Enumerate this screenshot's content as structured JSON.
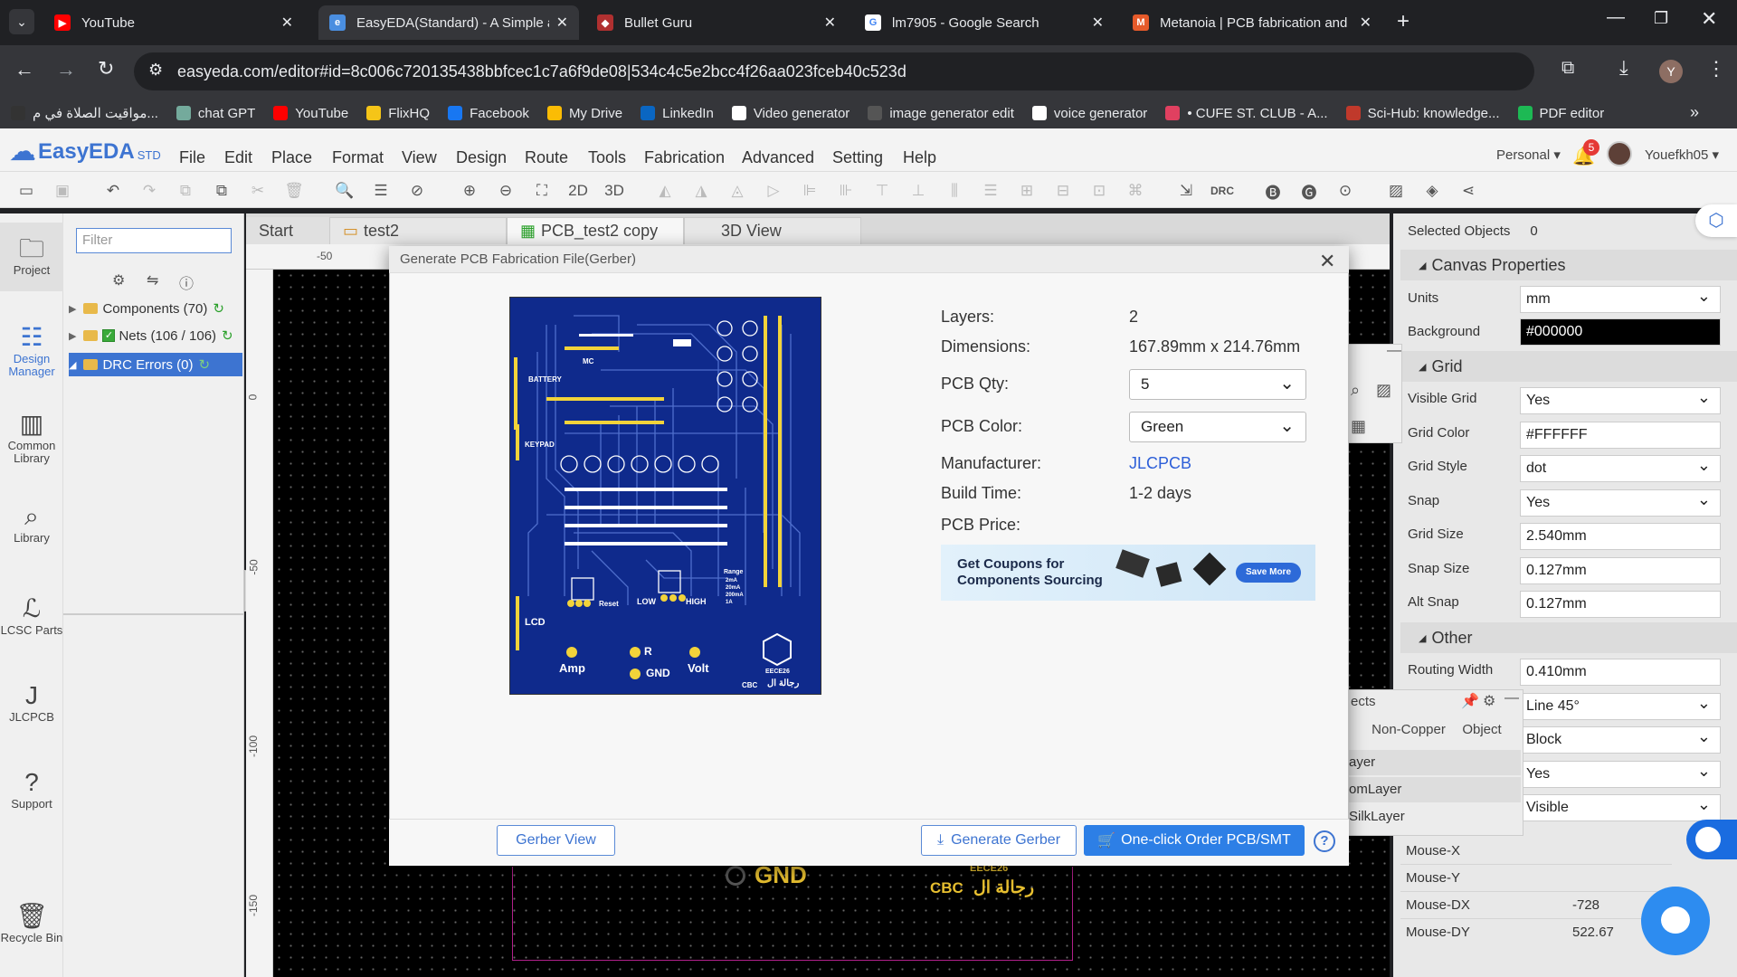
{
  "browser": {
    "tabs": [
      {
        "title": "YouTube",
        "color": "#ff0000",
        "glyph": "▶"
      },
      {
        "title": "EasyEDA(Standard) - A Simple a",
        "color": "#4a8ee0",
        "glyph": "e"
      },
      {
        "title": "Bullet Guru",
        "color": "#b03030",
        "glyph": "◆"
      },
      {
        "title": "lm7905 - Google Search",
        "color": "#ffffff",
        "glyph": "G"
      },
      {
        "title": "Metanoia | PCB fabrication and",
        "color": "#e65a2a",
        "glyph": "M"
      }
    ],
    "url": "easyeda.com/editor#id=8c006c720135438bbfcec1c7a6f9de08|534c4c5e2bcc4f26aa023fceb40c523d",
    "profile_initial": "Y",
    "bookmarks": [
      {
        "label": "مواقيت الصلاة في م...",
        "color": "#333"
      },
      {
        "label": "chat GPT",
        "color": "#74aa9c"
      },
      {
        "label": "YouTube",
        "color": "#ff0000"
      },
      {
        "label": "FlixHQ",
        "color": "#f5c518"
      },
      {
        "label": "Facebook",
        "color": "#1877f2"
      },
      {
        "label": "My Drive",
        "color": "#fbbc04"
      },
      {
        "label": "LinkedIn",
        "color": "#0a66c2"
      },
      {
        "label": "Video generator",
        "color": "#ffffff"
      },
      {
        "label": "image generator edit",
        "color": "#555"
      },
      {
        "label": "voice generator",
        "color": "#ffffff"
      },
      {
        "label": "• CUFE ST. CLUB - A...",
        "color": "#e04060"
      },
      {
        "label": "Sci-Hub: knowledge...",
        "color": "#c0392b"
      },
      {
        "label": "PDF editor",
        "color": "#1db954"
      }
    ]
  },
  "app": {
    "logo": "EasyEDA",
    "logo_suffix": "STD",
    "menus": [
      "File",
      "Edit",
      "Place",
      "Format",
      "View",
      "Design",
      "Route",
      "Tools",
      "Fabrication",
      "Advanced",
      "Setting",
      "Help"
    ],
    "account": "Personal",
    "notifications": "5",
    "username": "Youefkh05",
    "toolbar_text": {
      "view2d": "2D",
      "view3d": "3D",
      "drc": "DRC"
    }
  },
  "left_nav": [
    {
      "label": "Project",
      "icon": "folder-icon"
    },
    {
      "label": "Design Manager",
      "icon": "list-icon"
    },
    {
      "label": "Common Library",
      "icon": "chip-icon"
    },
    {
      "label": "Library",
      "icon": "search-icon"
    },
    {
      "label": "LCSC Parts",
      "icon": "lcsc-icon"
    },
    {
      "label": "JLCPCB",
      "icon": "jlc-icon"
    },
    {
      "label": "Support",
      "icon": "help-icon"
    },
    {
      "label": "Recycle Bin",
      "icon": "trash-icon"
    }
  ],
  "design_manager": {
    "filter_placeholder": "Filter",
    "tree": [
      "Components (70)",
      "Nets (106 / 106)",
      "DRC Errors (0)"
    ]
  },
  "doc_tabs": [
    "Start",
    "test2",
    "PCB_test2 copy",
    "3D View"
  ],
  "rulers": {
    "top": [
      "-50"
    ],
    "left": [
      "0",
      "-50",
      "-100",
      "-150"
    ]
  },
  "canvas_bg_text": {
    "gnd": "GND",
    "cbc": "CBC",
    "arabic": "رجالة ال",
    "code": "EECE26"
  },
  "right_panel": {
    "selected_label": "Selected Objects",
    "selected_count": "0",
    "canvas_title": "Canvas Properties",
    "units_label": "Units",
    "units": "mm",
    "background_label": "Background",
    "background": "#000000",
    "grid_title": "Grid",
    "visible_grid_label": "Visible Grid",
    "visible_grid": "Yes",
    "grid_color_label": "Grid Color",
    "grid_color": "#FFFFFF",
    "grid_style_label": "Grid Style",
    "grid_style": "dot",
    "snap_label": "Snap",
    "snap": "Yes",
    "grid_size_label": "Grid Size",
    "grid_size": "2.540mm",
    "snap_size_label": "Snap Size",
    "snap_size": "0.127mm",
    "alt_snap_label": "Alt Snap",
    "alt_snap": "0.127mm",
    "other_title": "Other",
    "routing_width_label": "Routing Width",
    "routing_width": "0.410mm",
    "extra_values": [
      "Line 45°",
      "Block",
      "Yes",
      "Visible"
    ],
    "mouse": [
      {
        "label": "Mouse-X",
        "value": ""
      },
      {
        "label": "Mouse-Y",
        "value": ""
      },
      {
        "label": "Mouse-DX",
        "value": "-728"
      },
      {
        "label": "Mouse-DY",
        "value": "522.67"
      }
    ]
  },
  "layer_panel": {
    "title": "ects",
    "tabs": [
      "Non-Copper",
      "Object"
    ],
    "rows": [
      "ayer",
      "omLayer",
      "SilkLayer"
    ]
  },
  "modal": {
    "title": "Generate PCB Fabrication File(Gerber)",
    "layers_label": "Layers:",
    "layers": "2",
    "dimensions_label": "Dimensions:",
    "dimensions": "167.89mm x 214.76mm",
    "qty_label": "PCB Qty:",
    "qty": "5",
    "color_label": "PCB Color:",
    "color": "Green",
    "manufacturer_label": "Manufacturer:",
    "manufacturer": "JLCPCB",
    "build_label": "Build Time:",
    "build": "1-2 days",
    "price_label": "PCB Price:",
    "coupon_text_1": "Get Coupons for",
    "coupon_text_2": "Components Sourcing",
    "coupon_button": "Save More",
    "gerber_view": "Gerber View",
    "generate": "Generate Gerber",
    "order": "One-click Order PCB/SMT",
    "pcb_labels": {
      "battery": "BATTERY",
      "mc": "MC",
      "keypad": "KEYPAD",
      "lcd": "LCD",
      "reset": "Reset",
      "low": "LOW",
      "high": "HIGH",
      "range": "Range",
      "r1": "2mA",
      "r2": "20mA",
      "r3": "200mA",
      "r4": "1A",
      "amp": "Amp",
      "r": "R",
      "gnd": "GND",
      "volt": "Volt",
      "code": "EECE26",
      "cbc": "CBC",
      "arabic": "رجالة ال"
    }
  }
}
